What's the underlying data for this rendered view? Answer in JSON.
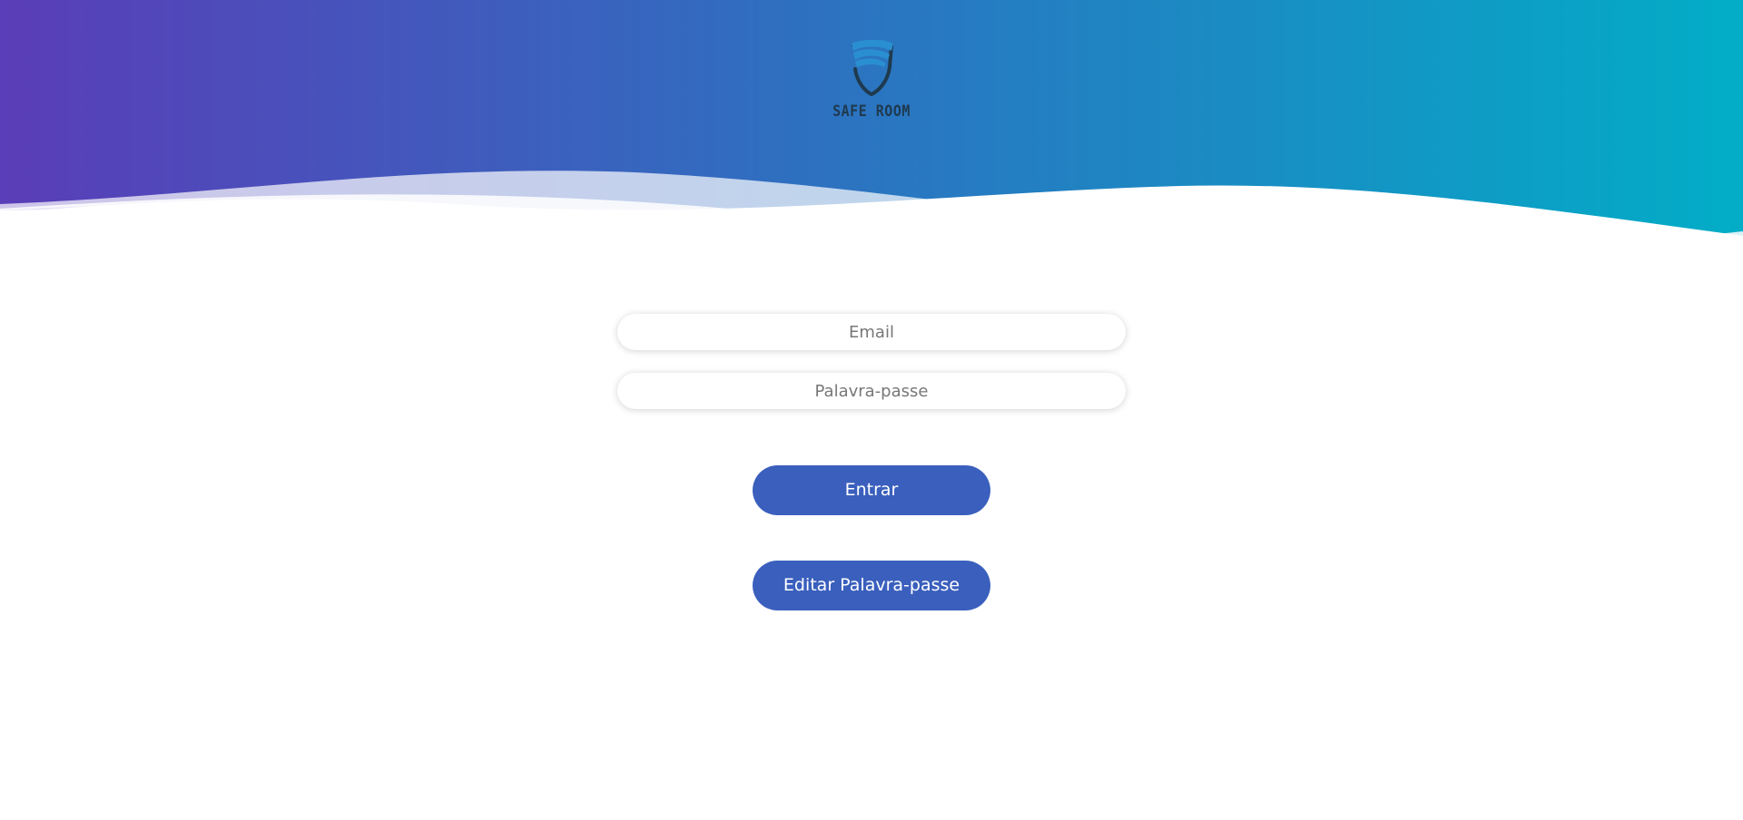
{
  "brand": {
    "name": "SAFE ROOM",
    "logo_icon": "shield-icon"
  },
  "colors": {
    "gradient_start": "#5a3db8",
    "gradient_mid": "#2f6fc0",
    "gradient_end": "#02adc7",
    "button": "#3a5fbd",
    "logo_dark": "#1f3a4f",
    "logo_light": "#2a8fd0"
  },
  "form": {
    "email_placeholder": "Email",
    "password_placeholder": "Palavra-passe",
    "login_label": "Entrar",
    "edit_password_label": "Editar Palavra-passe"
  }
}
